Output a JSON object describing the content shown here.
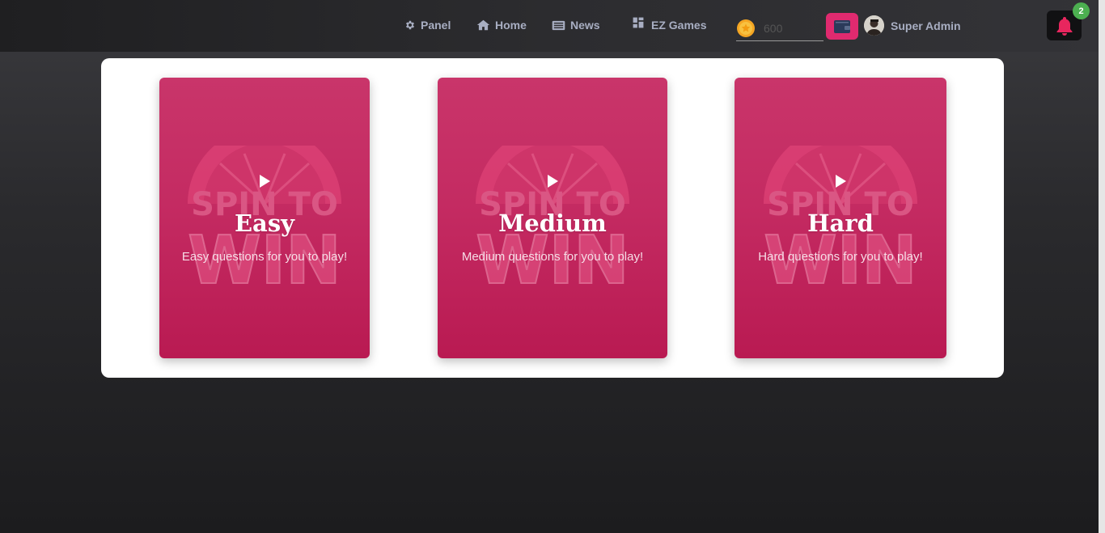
{
  "nav": {
    "panel_label": "Panel",
    "home_label": "Home",
    "news_label": "News",
    "ezgames_label": "EZ Games"
  },
  "coins": {
    "placeholder": "600",
    "icon": "coin-icon"
  },
  "wallet": {
    "icon": "wallet-icon"
  },
  "user": {
    "name": "Super Admin"
  },
  "notifications": {
    "count": "2",
    "icon": "bell-icon"
  },
  "colors": {
    "accent": "#e02a6f",
    "card_pink": "#c42b62",
    "badge_green": "#4caf50"
  },
  "cards": [
    {
      "title": "Easy",
      "description": "Easy questions for you to play!"
    },
    {
      "title": "Medium",
      "description": "Medium questions for you to play!"
    },
    {
      "title": "Hard",
      "description": "Hard questions for you to play!"
    }
  ]
}
